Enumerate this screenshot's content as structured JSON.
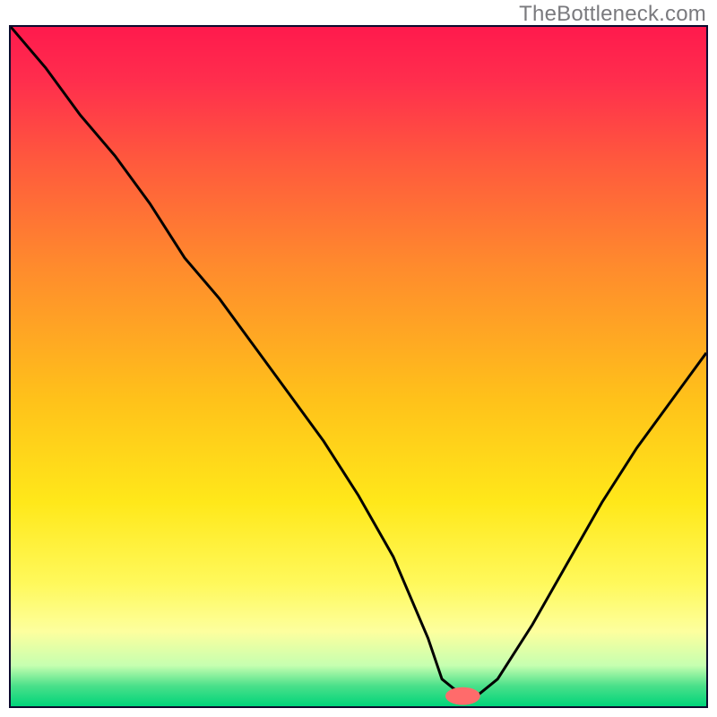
{
  "watermark": "TheBottleneck.com",
  "colors": {
    "border": "#0b0b2e",
    "curve": "#000000",
    "marker_fill": "#ff6b6b",
    "gradient_top": "#ff1a4d",
    "gradient_bottom": "#00d47a"
  },
  "chart_data": {
    "type": "line",
    "title": "",
    "xlabel": "",
    "ylabel": "",
    "xlim": [
      0,
      100
    ],
    "ylim": [
      0,
      100
    ],
    "grid": false,
    "legend": false,
    "marker": {
      "x": 65,
      "y": 1.5,
      "rx": 2.5,
      "ry": 1.3
    },
    "x": [
      0,
      5,
      10,
      15,
      20,
      25,
      30,
      35,
      40,
      45,
      50,
      55,
      60,
      62,
      65,
      67,
      70,
      75,
      80,
      85,
      90,
      95,
      100
    ],
    "y": [
      100,
      94,
      87,
      81,
      74,
      66,
      60,
      53,
      46,
      39,
      31,
      22,
      10,
      4,
      1.5,
      1.5,
      4,
      12,
      21,
      30,
      38,
      45,
      52
    ],
    "notes": "y is percentage height from bottom; values estimated from pixel positions"
  }
}
